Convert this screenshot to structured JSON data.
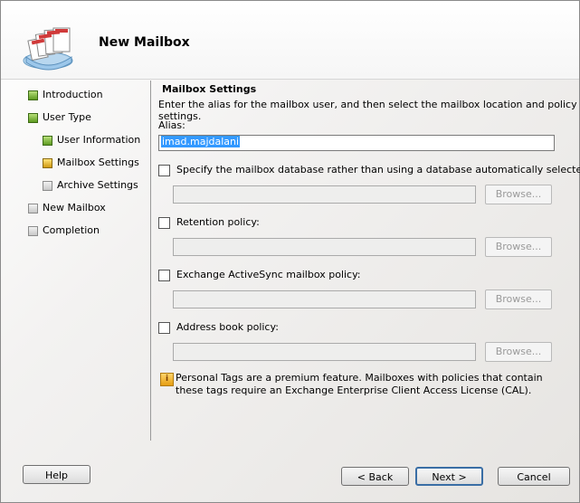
{
  "window": {
    "title": "New Mailbox"
  },
  "nav": {
    "items": [
      {
        "label": "Introduction",
        "state": "done"
      },
      {
        "label": "User Type",
        "state": "done"
      },
      {
        "label": "User Information",
        "state": "done"
      },
      {
        "label": "Mailbox Settings",
        "state": "current"
      },
      {
        "label": "Archive Settings",
        "state": "pending"
      },
      {
        "label": "New Mailbox",
        "state": "pending"
      },
      {
        "label": "Completion",
        "state": "pending"
      }
    ]
  },
  "main": {
    "section_title": "Mailbox Settings",
    "intro": "Enter the alias for the mailbox user, and then select the mailbox location and policy settings.",
    "alias_label": "Alias:",
    "alias_value": "imad.majdalani",
    "options": [
      {
        "label": "Specify the mailbox database rather than using a database automatically selected:",
        "checked": false,
        "browse_label": "Browse..."
      },
      {
        "label": "Retention policy:",
        "checked": false,
        "browse_label": "Browse..."
      },
      {
        "label": "Exchange ActiveSync mailbox policy:",
        "checked": false,
        "browse_label": "Browse..."
      },
      {
        "label": "Address book policy:",
        "checked": false,
        "browse_label": "Browse..."
      }
    ],
    "info_text": "Personal Tags are a premium feature. Mailboxes with policies that contain these tags require an Exchange Enterprise Client Access License (CAL)."
  },
  "footer": {
    "help_label": "Help",
    "back_label": "< Back",
    "next_label": "Next >",
    "cancel_label": "Cancel"
  },
  "icons": {
    "info": "info-icon",
    "logo": "mailbox-wizard-icon"
  },
  "colors": {
    "selection": "#3399ff",
    "step_done": "#5d9a1f",
    "step_current": "#d09a10"
  }
}
